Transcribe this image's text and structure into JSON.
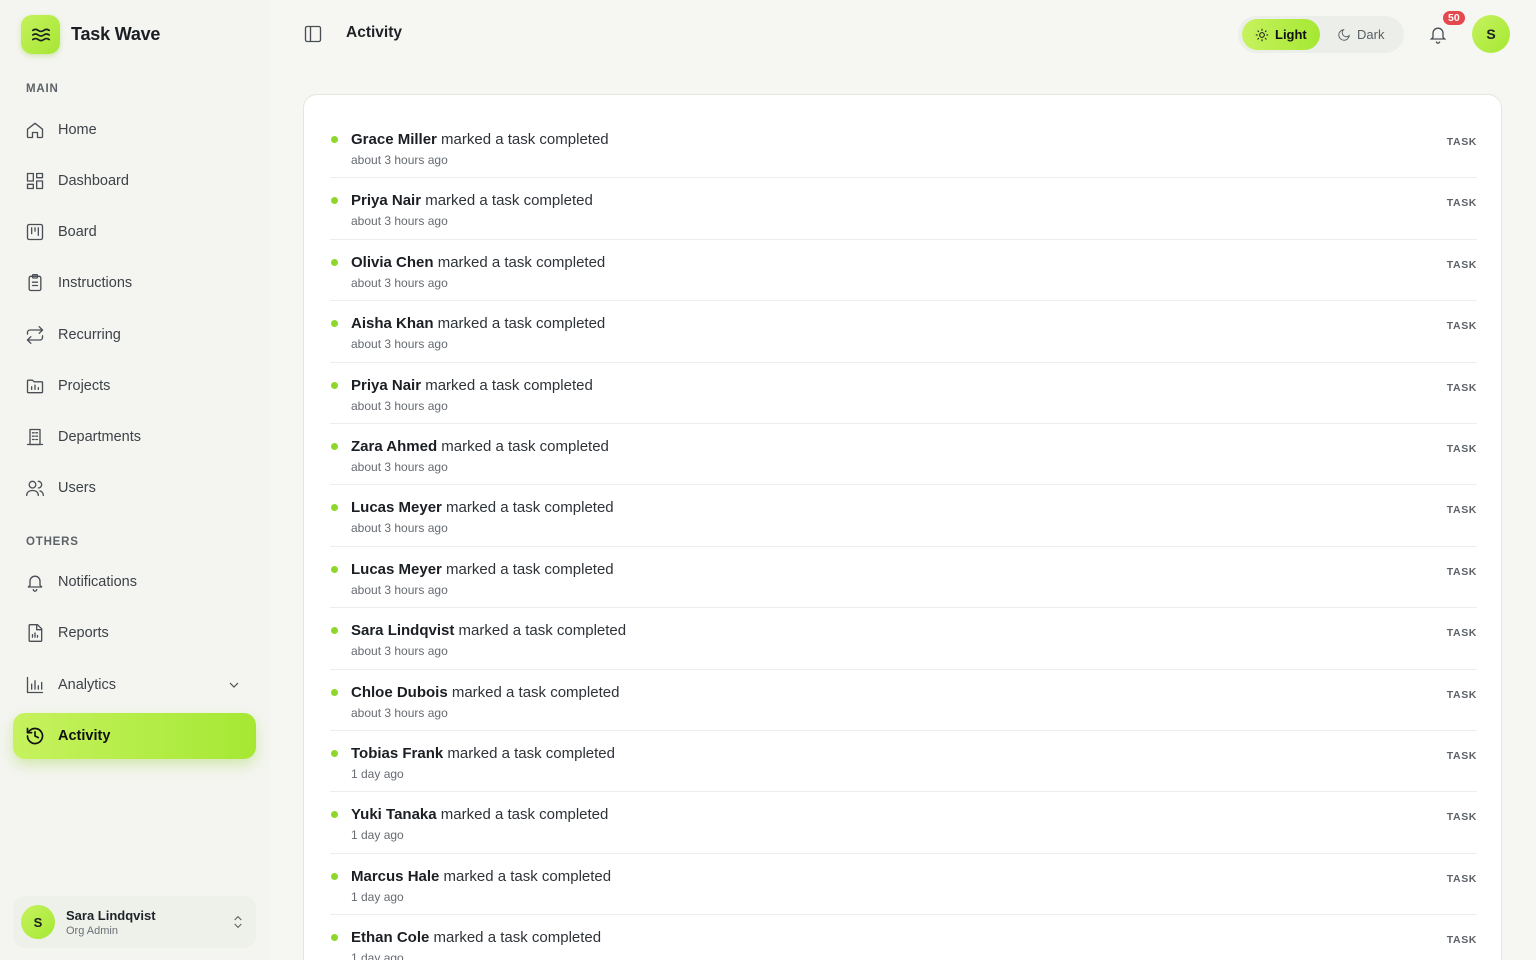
{
  "app": {
    "name": "Task Wave"
  },
  "sidebar": {
    "sections": {
      "main": "MAIN",
      "others": "OTHERS"
    },
    "items": [
      {
        "label": "Home",
        "icon": "home-icon"
      },
      {
        "label": "Dashboard",
        "icon": "dashboard-icon"
      },
      {
        "label": "Board",
        "icon": "board-icon"
      },
      {
        "label": "Instructions",
        "icon": "clipboard-icon"
      },
      {
        "label": "Recurring",
        "icon": "repeat-icon"
      },
      {
        "label": "Projects",
        "icon": "folder-chart-icon"
      },
      {
        "label": "Departments",
        "icon": "building-icon"
      },
      {
        "label": "Users",
        "icon": "users-icon"
      },
      {
        "label": "Notifications",
        "icon": "bell-icon"
      },
      {
        "label": "Reports",
        "icon": "report-icon"
      },
      {
        "label": "Analytics",
        "icon": "bar-chart-icon"
      },
      {
        "label": "Activity",
        "icon": "history-icon",
        "active": true
      }
    ],
    "user": {
      "initial": "S",
      "name": "Sara Lindqvist",
      "role": "Org Admin"
    }
  },
  "header": {
    "title": "Activity",
    "theme": {
      "light": "Light",
      "dark": "Dark",
      "selected": "Light"
    },
    "notifications_count": "50",
    "avatar_initial": "S"
  },
  "colors": {
    "accent": "#a5e833",
    "accent_light": "#c6f25e",
    "badge": "#e5484d",
    "dot": "#8fd62a"
  },
  "activity": [
    {
      "actor": "Grace Miller",
      "action": " marked a task completed",
      "time": "about 3 hours ago",
      "tag": "TASK"
    },
    {
      "actor": "Priya Nair",
      "action": " marked a task completed",
      "time": "about 3 hours ago",
      "tag": "TASK"
    },
    {
      "actor": "Olivia Chen",
      "action": " marked a task completed",
      "time": "about 3 hours ago",
      "tag": "TASK"
    },
    {
      "actor": "Aisha Khan",
      "action": " marked a task completed",
      "time": "about 3 hours ago",
      "tag": "TASK"
    },
    {
      "actor": "Priya Nair",
      "action": " marked a task completed",
      "time": "about 3 hours ago",
      "tag": "TASK"
    },
    {
      "actor": "Zara Ahmed",
      "action": " marked a task completed",
      "time": "about 3 hours ago",
      "tag": "TASK"
    },
    {
      "actor": "Lucas Meyer",
      "action": " marked a task completed",
      "time": "about 3 hours ago",
      "tag": "TASK"
    },
    {
      "actor": "Lucas Meyer",
      "action": " marked a task completed",
      "time": "about 3 hours ago",
      "tag": "TASK"
    },
    {
      "actor": "Sara Lindqvist",
      "action": " marked a task completed",
      "time": "about 3 hours ago",
      "tag": "TASK"
    },
    {
      "actor": "Chloe Dubois",
      "action": " marked a task completed",
      "time": "about 3 hours ago",
      "tag": "TASK"
    },
    {
      "actor": "Tobias Frank",
      "action": " marked a task completed",
      "time": "1 day ago",
      "tag": "TASK"
    },
    {
      "actor": "Yuki Tanaka",
      "action": " marked a task completed",
      "time": "1 day ago",
      "tag": "TASK"
    },
    {
      "actor": "Marcus Hale",
      "action": " marked a task completed",
      "time": "1 day ago",
      "tag": "TASK"
    },
    {
      "actor": "Ethan Cole",
      "action": " marked a task completed",
      "time": "1 day ago",
      "tag": "TASK"
    }
  ]
}
